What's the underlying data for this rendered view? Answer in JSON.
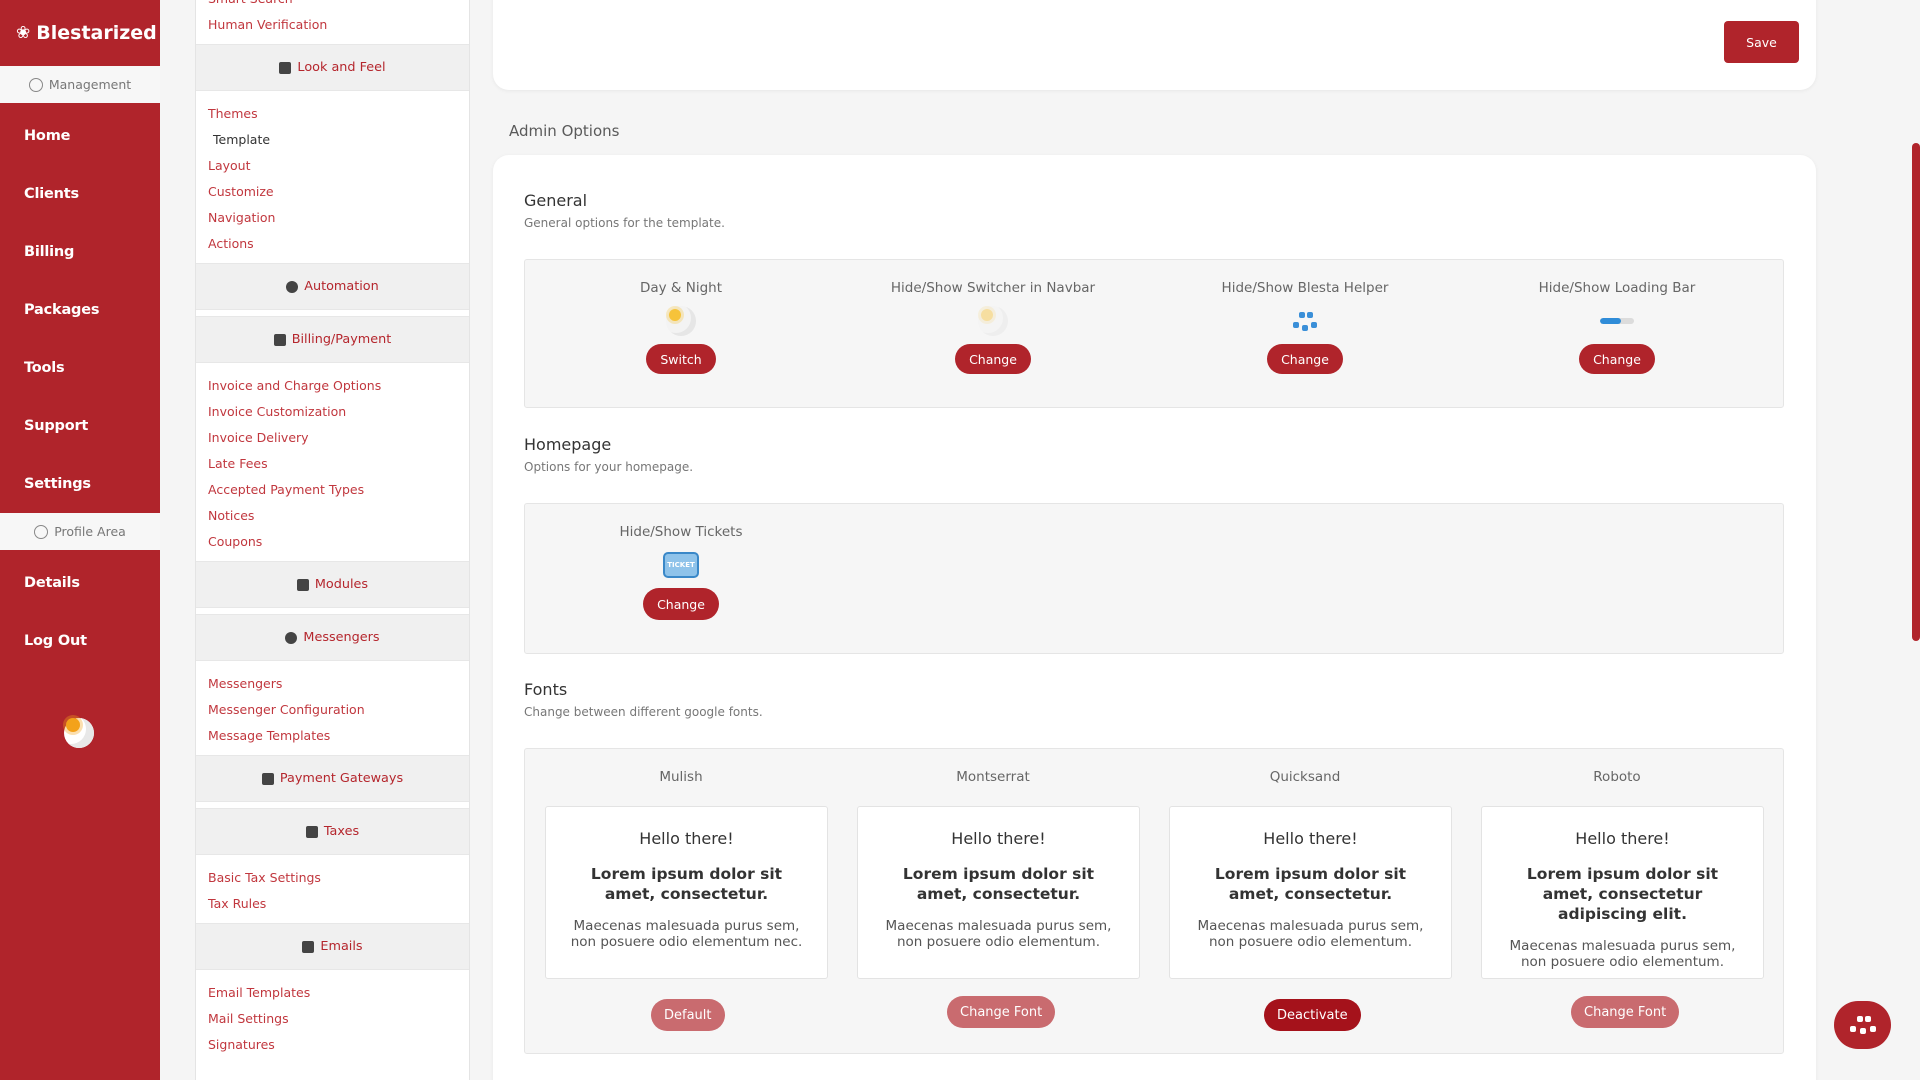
{
  "brand": {
    "name": "Blestarized"
  },
  "sidebar": {
    "management_label": "Management",
    "items": [
      "Home",
      "Clients",
      "Billing",
      "Packages",
      "Tools",
      "Support",
      "Settings"
    ],
    "profile_label": "Profile Area",
    "profile_items": [
      "Details",
      "Log Out"
    ]
  },
  "submenu": {
    "top_links": [
      "Smart Search",
      "Human Verification"
    ],
    "look_and_feel": {
      "title": "Look and Feel",
      "links": [
        "Themes",
        "Template",
        "Layout",
        "Customize",
        "Navigation",
        "Actions"
      ],
      "active": "Template"
    },
    "automation": {
      "title": "Automation"
    },
    "billing": {
      "title": "Billing/Payment",
      "links": [
        "Invoice and Charge Options",
        "Invoice Customization",
        "Invoice Delivery",
        "Late Fees",
        "Accepted Payment Types",
        "Notices",
        "Coupons"
      ]
    },
    "modules": {
      "title": "Modules"
    },
    "messengers": {
      "title": "Messengers",
      "links": [
        "Messengers",
        "Messenger Configuration",
        "Message Templates"
      ]
    },
    "payment_gateways": {
      "title": "Payment Gateways"
    },
    "taxes": {
      "title": "Taxes",
      "links": [
        "Basic Tax Settings",
        "Tax Rules"
      ]
    },
    "emails": {
      "title": "Emails",
      "links": [
        "Email Templates",
        "Mail Settings",
        "Signatures"
      ]
    }
  },
  "top_card": {
    "save_label": "Save"
  },
  "admin_options_title": "Admin Options",
  "general": {
    "title": "General",
    "subtitle": "General options for the template.",
    "options": [
      {
        "label": "Day & Night",
        "button": "Switch",
        "icon": "sun-moon-icon"
      },
      {
        "label": "Hide/Show Switcher in Navbar",
        "button": "Change",
        "icon": "sun-moon-faded-icon"
      },
      {
        "label": "Hide/Show Blesta Helper",
        "button": "Change",
        "icon": "helper-face-icon"
      },
      {
        "label": "Hide/Show Loading Bar",
        "button": "Change",
        "icon": "loading-bar-icon"
      }
    ]
  },
  "homepage": {
    "title": "Homepage",
    "subtitle": "Options for your homepage.",
    "options": [
      {
        "label": "Hide/Show Tickets",
        "button": "Change",
        "icon": "ticket-icon",
        "icon_text": "TICKET"
      }
    ]
  },
  "fonts": {
    "title": "Fonts",
    "subtitle": "Change between different google fonts.",
    "items": [
      {
        "name": "Mulish",
        "hello": "Hello there!",
        "lorem": "Lorem ipsum dolor sit amet, consectetur.",
        "para": "Maecenas malesuada purus sem, non posuere odio elementum nec.",
        "button": "Default"
      },
      {
        "name": "Montserrat",
        "hello": "Hello there!",
        "lorem": "Lorem ipsum dolor sit amet, consectetur.",
        "para": "Maecenas malesuada purus sem, non posuere odio elementum.",
        "button": "Change Font"
      },
      {
        "name": "Quicksand",
        "hello": "Hello there!",
        "lorem": "Lorem ipsum dolor sit amet, consectetur.",
        "para": "Maecenas malesuada purus sem, non posuere odio elementum.",
        "button": "Deactivate"
      },
      {
        "name": "Roboto",
        "hello": "Hello there!",
        "lorem": "Lorem ipsum dolor sit amet, consectetur adipiscing elit.",
        "para": "Maecenas malesuada purus sem, non posuere odio elementum.",
        "button": "Change Font"
      }
    ]
  },
  "colors": {
    "accent": "#b0242b",
    "accent_light": "#c96b6f",
    "accent_dark": "#a5121b",
    "link": "#c1373e"
  }
}
